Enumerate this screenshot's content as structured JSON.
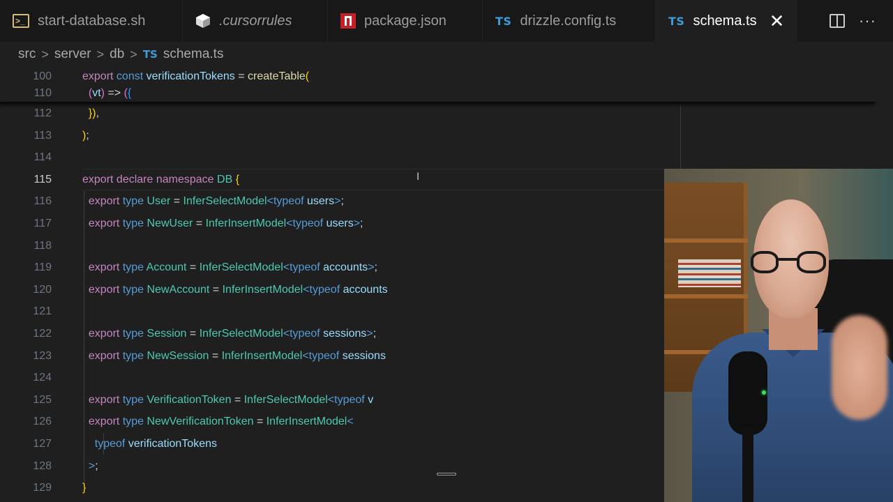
{
  "tabs": [
    {
      "label": "start-database.sh",
      "icon": "terminal-icon",
      "active": false
    },
    {
      "label": ".cursorrules",
      "icon": "cursor-icon",
      "active": false
    },
    {
      "label": "package.json",
      "icon": "npm-icon",
      "active": false
    },
    {
      "label": "drizzle.config.ts",
      "icon": "typescript-icon",
      "active": false
    },
    {
      "label": "schema.ts",
      "icon": "typescript-icon",
      "active": true
    }
  ],
  "tab_icon_text": {
    "typescript": "TS"
  },
  "tab_actions": {
    "close": "✕",
    "more": "···"
  },
  "breadcrumb": {
    "parts": [
      "src",
      "server",
      "db"
    ],
    "file": "schema.ts",
    "separator": ">"
  },
  "editor": {
    "sticky_lines": [
      {
        "num": "100",
        "text": "export const verificationTokens = createTable("
      },
      {
        "num": "110",
        "text": "  (vt) => ({"
      }
    ],
    "lines": [
      {
        "num": "112",
        "text": "  }),"
      },
      {
        "num": "113",
        "text": ");"
      },
      {
        "num": "114",
        "text": ""
      },
      {
        "num": "115",
        "text": "export declare namespace DB {"
      },
      {
        "num": "116",
        "text": "  export type User = InferSelectModel<typeof users>;"
      },
      {
        "num": "117",
        "text": "  export type NewUser = InferInsertModel<typeof users>;"
      },
      {
        "num": "118",
        "text": ""
      },
      {
        "num": "119",
        "text": "  export type Account = InferSelectModel<typeof accounts>;"
      },
      {
        "num": "120",
        "text": "  export type NewAccount = InferInsertModel<typeof accounts"
      },
      {
        "num": "121",
        "text": ""
      },
      {
        "num": "122",
        "text": "  export type Session = InferSelectModel<typeof sessions>;"
      },
      {
        "num": "123",
        "text": "  export type NewSession = InferInsertModel<typeof sessions"
      },
      {
        "num": "124",
        "text": ""
      },
      {
        "num": "125",
        "text": "  export type VerificationToken = InferSelectModel<typeof v"
      },
      {
        "num": "126",
        "text": "  export type NewVerificationToken = InferInsertModel<"
      },
      {
        "num": "127",
        "text": "    typeof verificationTokens"
      },
      {
        "num": "128",
        "text": "  >;"
      },
      {
        "num": "129",
        "text": "}"
      }
    ],
    "current_line": "115"
  },
  "colors": {
    "keyword": "#c586c0",
    "storage": "#569cd6",
    "type": "#4ec9b0",
    "variable": "#9cdcfe",
    "function": "#dcdcaa",
    "bracket1": "#ffd700",
    "bracket2": "#da70d6",
    "bracket3": "#179fff"
  }
}
